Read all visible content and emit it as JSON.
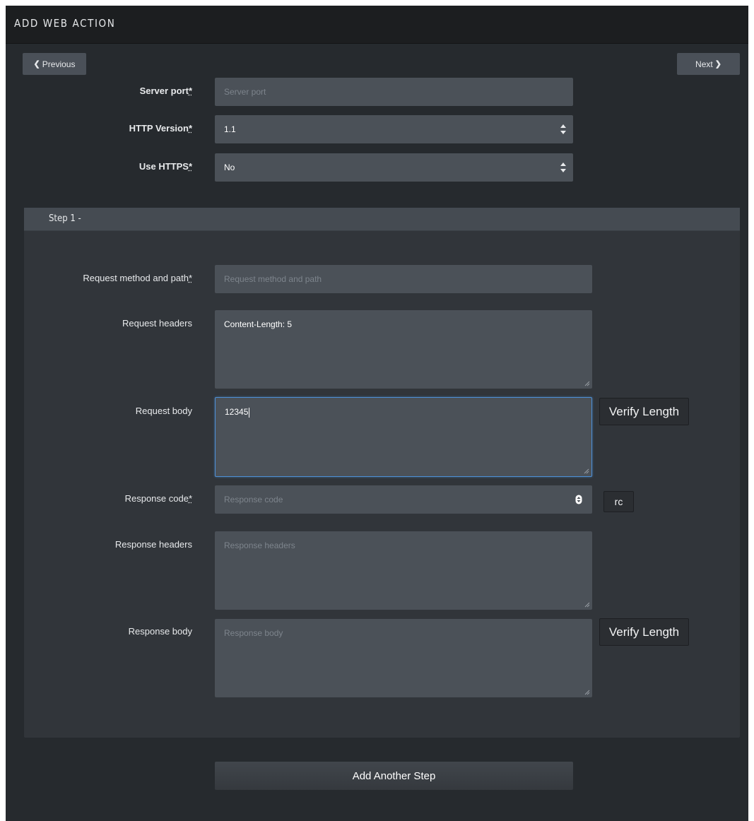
{
  "header": {
    "title": "ADD WEB ACTION"
  },
  "nav": {
    "previous_label": "Previous",
    "next_label": "Next"
  },
  "form": {
    "server_port": {
      "label": "Server port",
      "required_mark": "*",
      "placeholder": "Server port",
      "value": ""
    },
    "http_version": {
      "label": "HTTP Version",
      "required_mark": "*",
      "value": "1.1"
    },
    "use_https": {
      "label": "Use HTTPS",
      "required_mark": "*",
      "value": "No"
    }
  },
  "step": {
    "title": "Step 1 -",
    "request_method_path": {
      "label": "Request method and path",
      "required_mark": "*",
      "placeholder": "Request method and path",
      "value": ""
    },
    "request_headers": {
      "label": "Request headers",
      "value": "Content-Length: 5"
    },
    "request_body": {
      "label": "Request body",
      "value": "12345",
      "verify_label": "Verify Length"
    },
    "response_code": {
      "label": "Response code",
      "required_mark": "*",
      "placeholder": "Response code",
      "value": "",
      "rc_label": "rc"
    },
    "response_headers": {
      "label": "Response headers",
      "placeholder": "Response headers",
      "value": ""
    },
    "response_body": {
      "label": "Response body",
      "placeholder": "Response body",
      "value": "",
      "verify_label": "Verify Length"
    }
  },
  "actions": {
    "add_step_label": "Add Another Step"
  },
  "colors": {
    "panel": "#262a2e",
    "titlebar": "#1c1e20",
    "field": "#4b5158",
    "focus": "#4d8fd6"
  }
}
